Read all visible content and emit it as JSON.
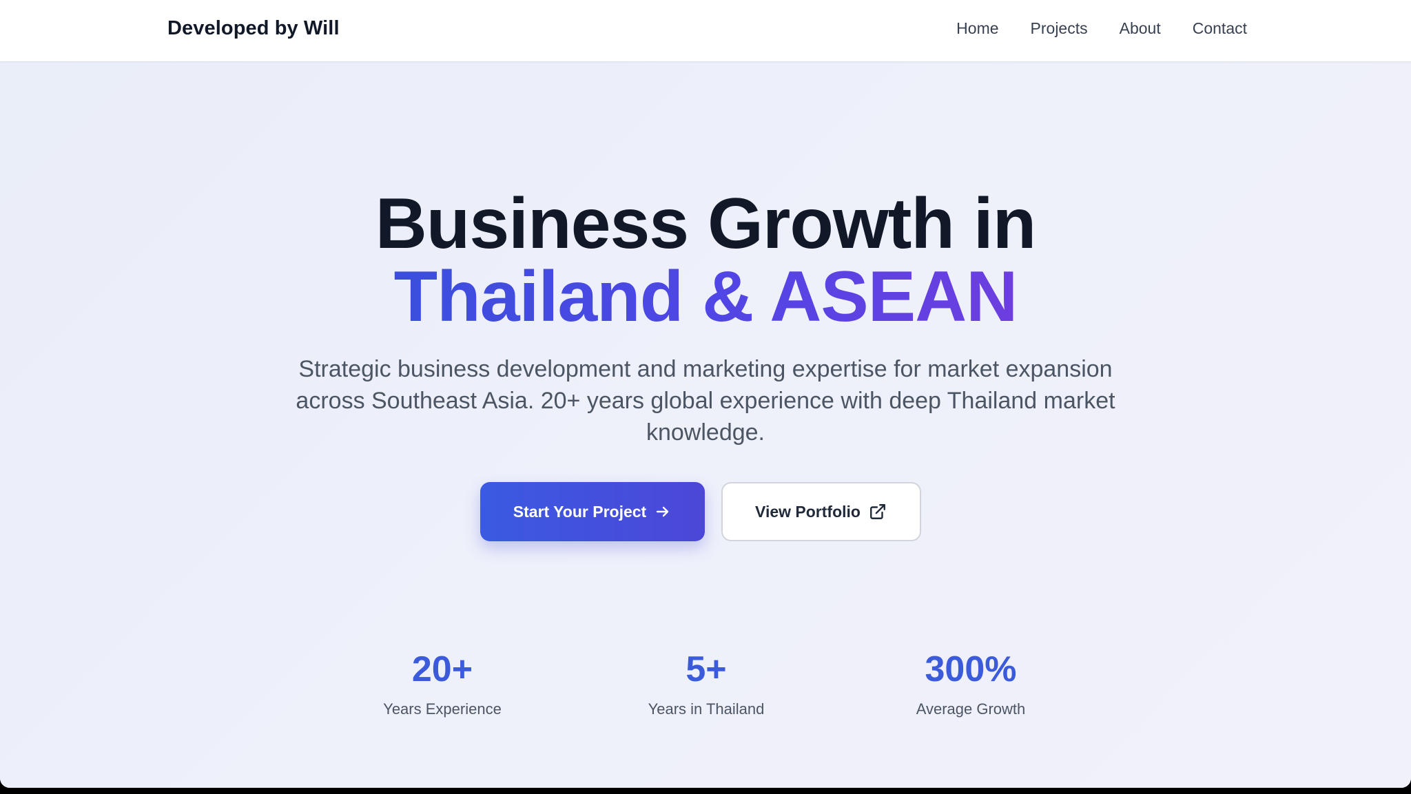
{
  "header": {
    "brand": "Developed by Will",
    "nav": [
      "Home",
      "Projects",
      "About",
      "Contact"
    ]
  },
  "hero": {
    "title_line1": "Business Growth in",
    "title_line2": "Thailand & ASEAN",
    "subtitle": "Strategic business development and marketing expertise for market expansion across Southeast Asia. 20+ years global experience with deep Thailand market knowledge.",
    "primary_button": "Start Your Project",
    "secondary_button": "View Portfolio",
    "primary_icon": "arrow-right-icon",
    "secondary_icon": "external-link-icon"
  },
  "stats": [
    {
      "value": "20+",
      "label": "Years Experience"
    },
    {
      "value": "5+",
      "label": "Years in Thailand"
    },
    {
      "value": "300%",
      "label": "Average Growth"
    }
  ],
  "colors": {
    "accent": "#3b5bdb",
    "gradient_start": "#3b4fdc",
    "gradient_end": "#6d3ee0",
    "heading": "#111827",
    "body_text": "#4b5563",
    "hero_background": "#eef0f9"
  }
}
